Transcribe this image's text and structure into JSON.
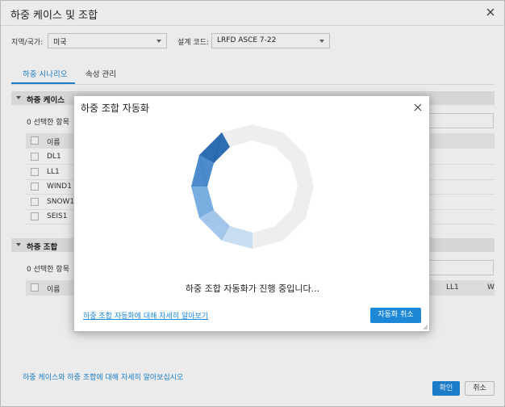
{
  "window": {
    "title": "하중 케이스 및 조합"
  },
  "filters": {
    "region_label": "지역/국가:",
    "region_value": "미국",
    "code_label": "설계 코드:",
    "code_value": "LRFD ASCE 7-22"
  },
  "tabs": [
    {
      "label": "하중 시나리오",
      "active": true
    },
    {
      "label": "속성 관리",
      "active": false
    }
  ],
  "load_cases": {
    "section_label": "하중 케이스",
    "selected_count": "0 선택한 항목",
    "column_name": "이름",
    "rows": [
      "DL1",
      "LL1",
      "WIND1",
      "SNOW1",
      "SEIS1"
    ]
  },
  "load_combinations": {
    "section_label": "하중 조합",
    "selected_count": "0 선택한 항목",
    "column_name": "이름",
    "extra_columns": [
      "LL1",
      "W"
    ]
  },
  "footer": {
    "help_link": "하중 케이스와 하중 조합에 대해 자세히 알아보십시오",
    "ok_label": "확인",
    "cancel_label": "취소"
  },
  "modal": {
    "title": "하중 조합 자동화",
    "progress_text": "하중 조합 자동화가 진행 중입니다...",
    "learn_more_link": "하중 조합 자동화에 대해 자세히 알아보기",
    "cancel_button": "자동화 취소"
  },
  "colors": {
    "accent": "#1e88d8",
    "spinner_dark": "#2d6db2",
    "spinner_light": "#b9d4ee",
    "spinner_track": "#eeeeee"
  }
}
